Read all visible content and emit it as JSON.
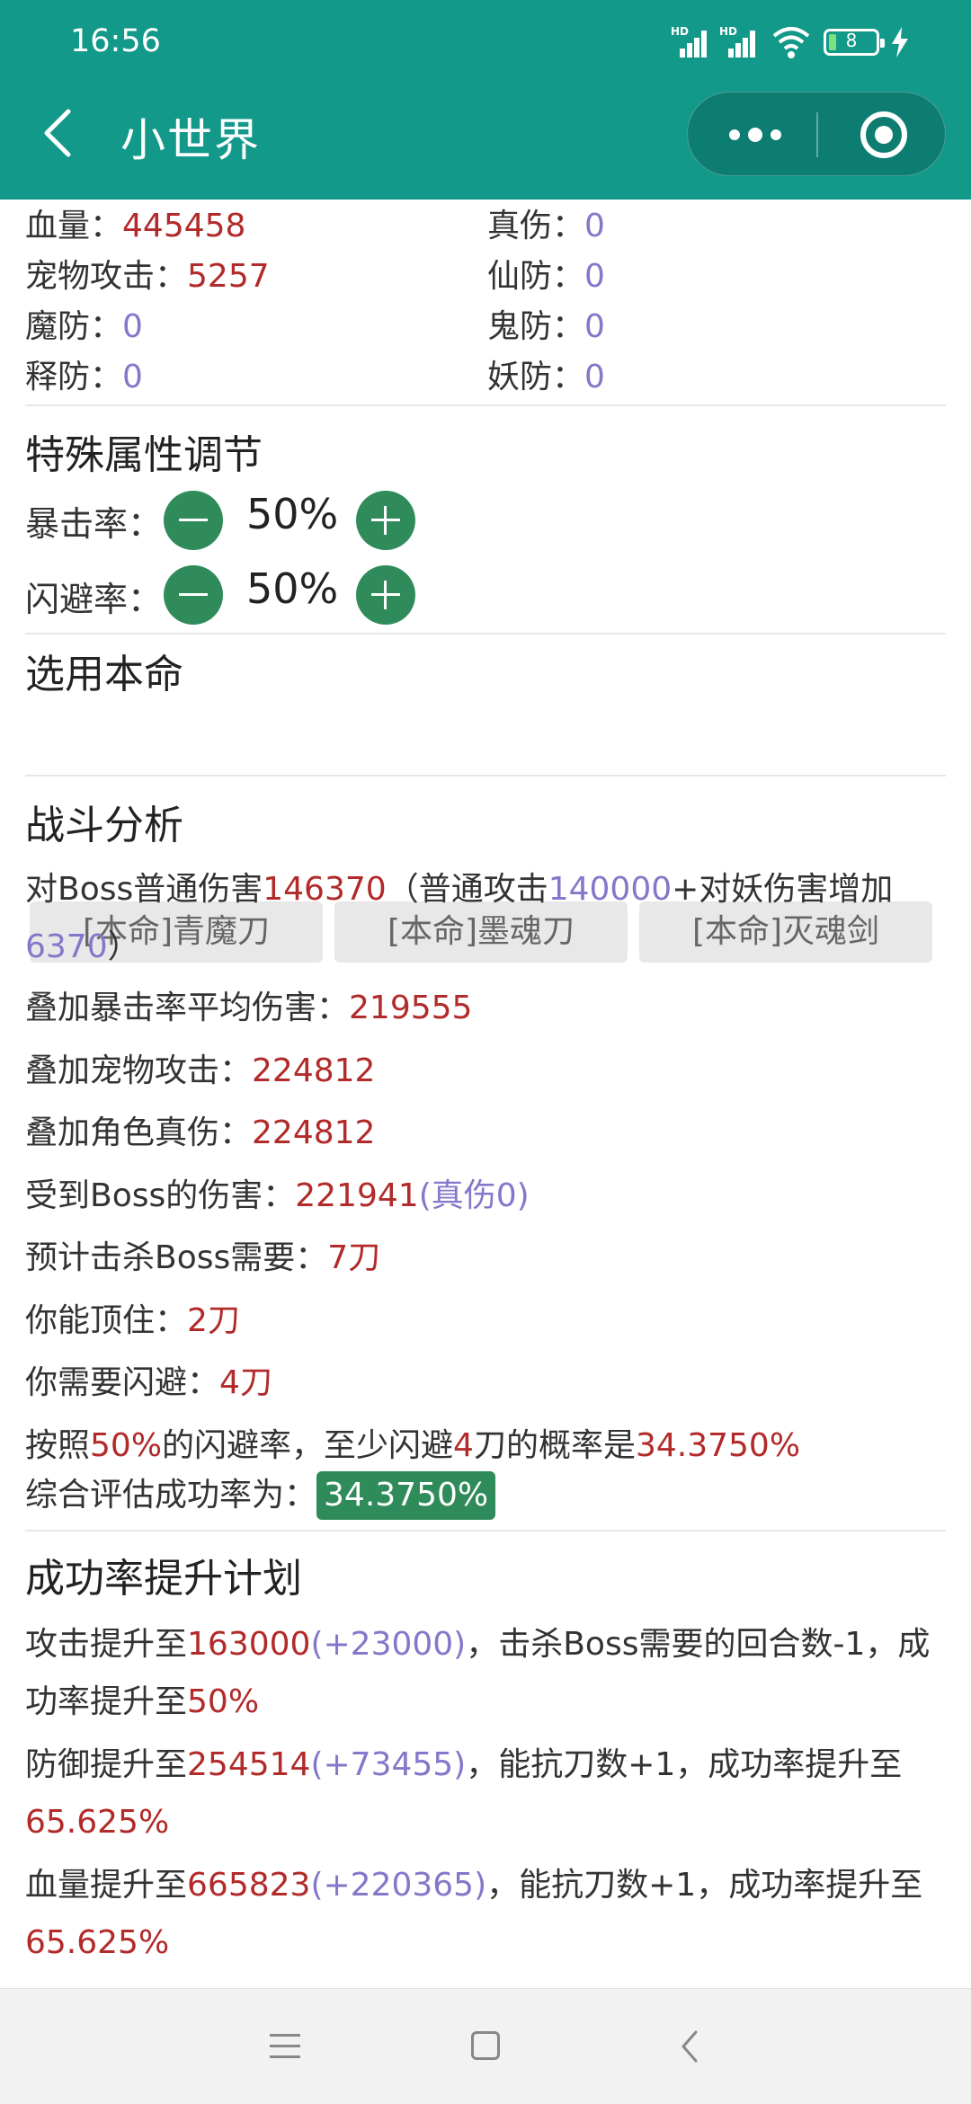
{
  "status_bar": {
    "time": "16:56",
    "battery": "8",
    "signal_label": "HD"
  },
  "header": {
    "title": "小世界"
  },
  "stats": [
    {
      "label": "血量：",
      "value": "445458",
      "color": "red"
    },
    {
      "label": "真伤：",
      "value": "0",
      "color": "purple"
    },
    {
      "label": "宠物攻击：",
      "value": "5257",
      "color": "red"
    },
    {
      "label": "仙防：",
      "value": "0",
      "color": "purple"
    },
    {
      "label": "魔防：",
      "value": "0",
      "color": "purple"
    },
    {
      "label": "鬼防：",
      "value": "0",
      "color": "purple"
    },
    {
      "label": "释防：",
      "value": "0",
      "color": "purple"
    },
    {
      "label": "妖防：",
      "value": "0",
      "color": "purple"
    }
  ],
  "special": {
    "title": "特殊属性调节",
    "crit_label": "暴击率：",
    "crit_value": "50%",
    "dodge_label": "闪避率：",
    "dodge_value": "50%"
  },
  "weapon": {
    "title": "选用本命",
    "options": [
      "[本命]青魔刀",
      "[本命]墨魂刀",
      "[本命]灭魂剑"
    ]
  },
  "analysis": {
    "title": "战斗分析",
    "l1_a": "对Boss普通伤害",
    "l1_b": "146370",
    "l1_c": "（普通攻击",
    "l1_d": "140000",
    "l1_e": "+对妖伤害增加",
    "l1_f": "6370",
    "l1_g": "）",
    "l2_a": "叠加暴击率平均伤害：",
    "l2_b": "219555",
    "l3_a": "叠加宠物攻击：",
    "l3_b": "224812",
    "l4_a": "叠加角色真伤：",
    "l4_b": "224812",
    "l5_a": "受到Boss的伤害：",
    "l5_b": "221941",
    "l5_c": "(真伤0)",
    "l6_a": "预计击杀Boss需要：",
    "l6_b": "7刀",
    "l7_a": "你能顶住：",
    "l7_b": "2刀",
    "l8_a": "你需要闪避：",
    "l8_b": "4刀",
    "l9_a": "按照",
    "l9_b": "50%",
    "l9_c": "的闪避率，至少闪避",
    "l9_d": "4",
    "l9_e": "刀的概率是",
    "l9_f": "34.3750%",
    "l10_a": "综合评估成功率为：",
    "l10_b": "34.3750%"
  },
  "plan": {
    "title": "成功率提升计划",
    "p1_a": "攻击提升至",
    "p1_b": "163000",
    "p1_c": "(+23000)",
    "p1_d": "，击杀Boss需要的回合数-1，成",
    "p1_e": "功率提升至",
    "p1_f": "50%",
    "p2_a": "防御提升至",
    "p2_b": "254514",
    "p2_c": "(+73455)",
    "p2_d": "，能抗刀数+1，成功率提升至",
    "p2_e": "65.625%",
    "p3_a": "血量提升至",
    "p3_b": "665823",
    "p3_c": "(+220365)",
    "p3_d": "，能抗刀数+1，成功率提升至",
    "p3_e": "65.625%"
  },
  "colors": {
    "header": "#12998a",
    "accent": "#2f8b5a",
    "red": "#b22a2a",
    "purple": "#8378c9"
  }
}
